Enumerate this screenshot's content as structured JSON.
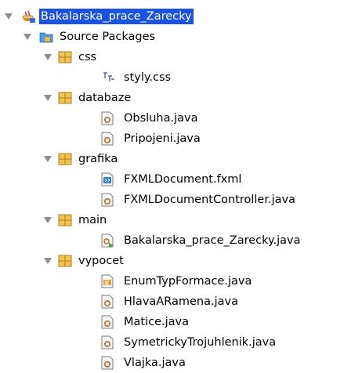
{
  "tree": {
    "project": {
      "label": "Bakalarska_prace_Zarecky",
      "icon": "java-project-icon",
      "selected": true
    },
    "source_packages": {
      "label": "Source Packages",
      "icon": "source-packages-icon"
    },
    "packages": [
      {
        "label": "css",
        "icon": "package-icon",
        "files": [
          {
            "label": "styly.css",
            "icon": "css-file-icon"
          }
        ]
      },
      {
        "label": "databaze",
        "icon": "package-icon",
        "files": [
          {
            "label": "Obsluha.java",
            "icon": "java-class-icon"
          },
          {
            "label": "Pripojeni.java",
            "icon": "java-class-icon"
          }
        ]
      },
      {
        "label": "grafika",
        "icon": "package-icon",
        "files": [
          {
            "label": "FXMLDocument.fxml",
            "icon": "fxml-file-icon"
          },
          {
            "label": "FXMLDocumentController.java",
            "icon": "java-class-icon"
          }
        ]
      },
      {
        "label": "main",
        "icon": "package-icon",
        "files": [
          {
            "label": "Bakalarska_prace_Zarecky.java",
            "icon": "java-main-class-icon"
          }
        ]
      },
      {
        "label": "vypocet",
        "icon": "package-icon",
        "files": [
          {
            "label": "EnumTypFormace.java",
            "icon": "java-enum-icon"
          },
          {
            "label": "HlavaARamena.java",
            "icon": "java-class-icon"
          },
          {
            "label": "Matice.java",
            "icon": "java-class-icon"
          },
          {
            "label": "SymetrickyTrojuhlenik.java",
            "icon": "java-class-icon"
          },
          {
            "label": "Vlajka.java",
            "icon": "java-class-icon"
          }
        ]
      }
    ]
  },
  "colors": {
    "selection": "#1a53e0",
    "package": "#e8b33c",
    "folder": "#3a8ee6",
    "toggle": "#8e8e8e"
  }
}
